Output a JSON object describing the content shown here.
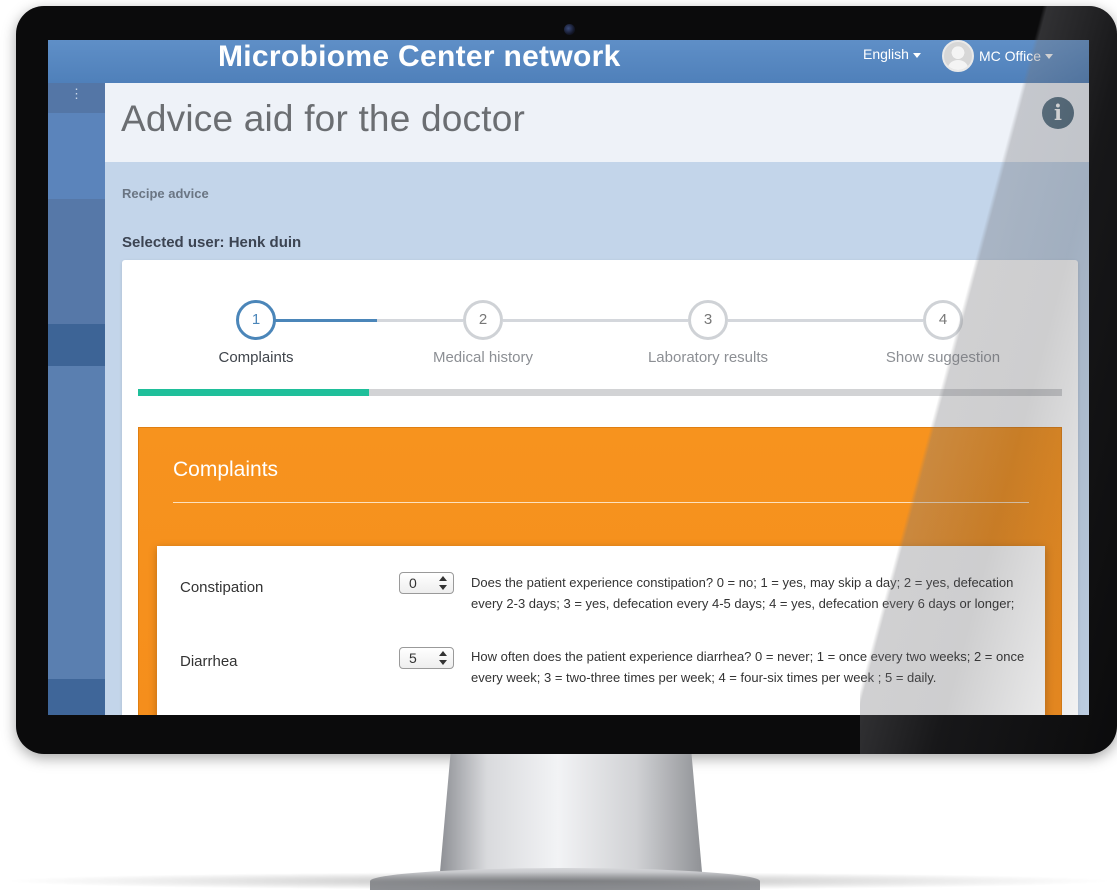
{
  "app": {
    "brand": "Microbiome Center network",
    "language": "English",
    "user_menu": "MC Office"
  },
  "page": {
    "title": "Advice aid for the doctor",
    "breadcrumb": "Recipe advice",
    "selected_user": "Selected user: Henk duin"
  },
  "wizard": {
    "steps": [
      {
        "number": "1",
        "label": "Complaints",
        "active": true
      },
      {
        "number": "2",
        "label": "Medical history",
        "active": false
      },
      {
        "number": "3",
        "label": "Laboratory results",
        "active": false
      },
      {
        "number": "4",
        "label": "Show suggestion",
        "active": false
      }
    ],
    "progress_fraction": 0.25
  },
  "section": {
    "title": "Complaints",
    "questions": [
      {
        "label": "Constipation",
        "value": "0",
        "description": "Does the patient experience constipation? 0 = no; 1 = yes, may skip a day; 2 = yes, defecation every 2-3 days; 3 = yes, defecation every 4-5 days; 4 = yes, defecation every 6 days or longer;"
      },
      {
        "label": "Diarrhea",
        "value": "5",
        "description": "How often does the patient experience diarrhea? 0 = never; 1 = once every two weeks; 2 = once every week; 3 = two-three times per week; 4 = four-six times per week ; 5 = daily."
      }
    ]
  },
  "colors": {
    "topbar": "#5585bf",
    "accent_blue": "#4b86b9",
    "progress": "#1fbf9a",
    "orange": "#f7931e",
    "background": "#c3d5ea"
  },
  "icons": {
    "info": "info-icon",
    "caret": "caret-down-icon",
    "avatar": "avatar"
  }
}
